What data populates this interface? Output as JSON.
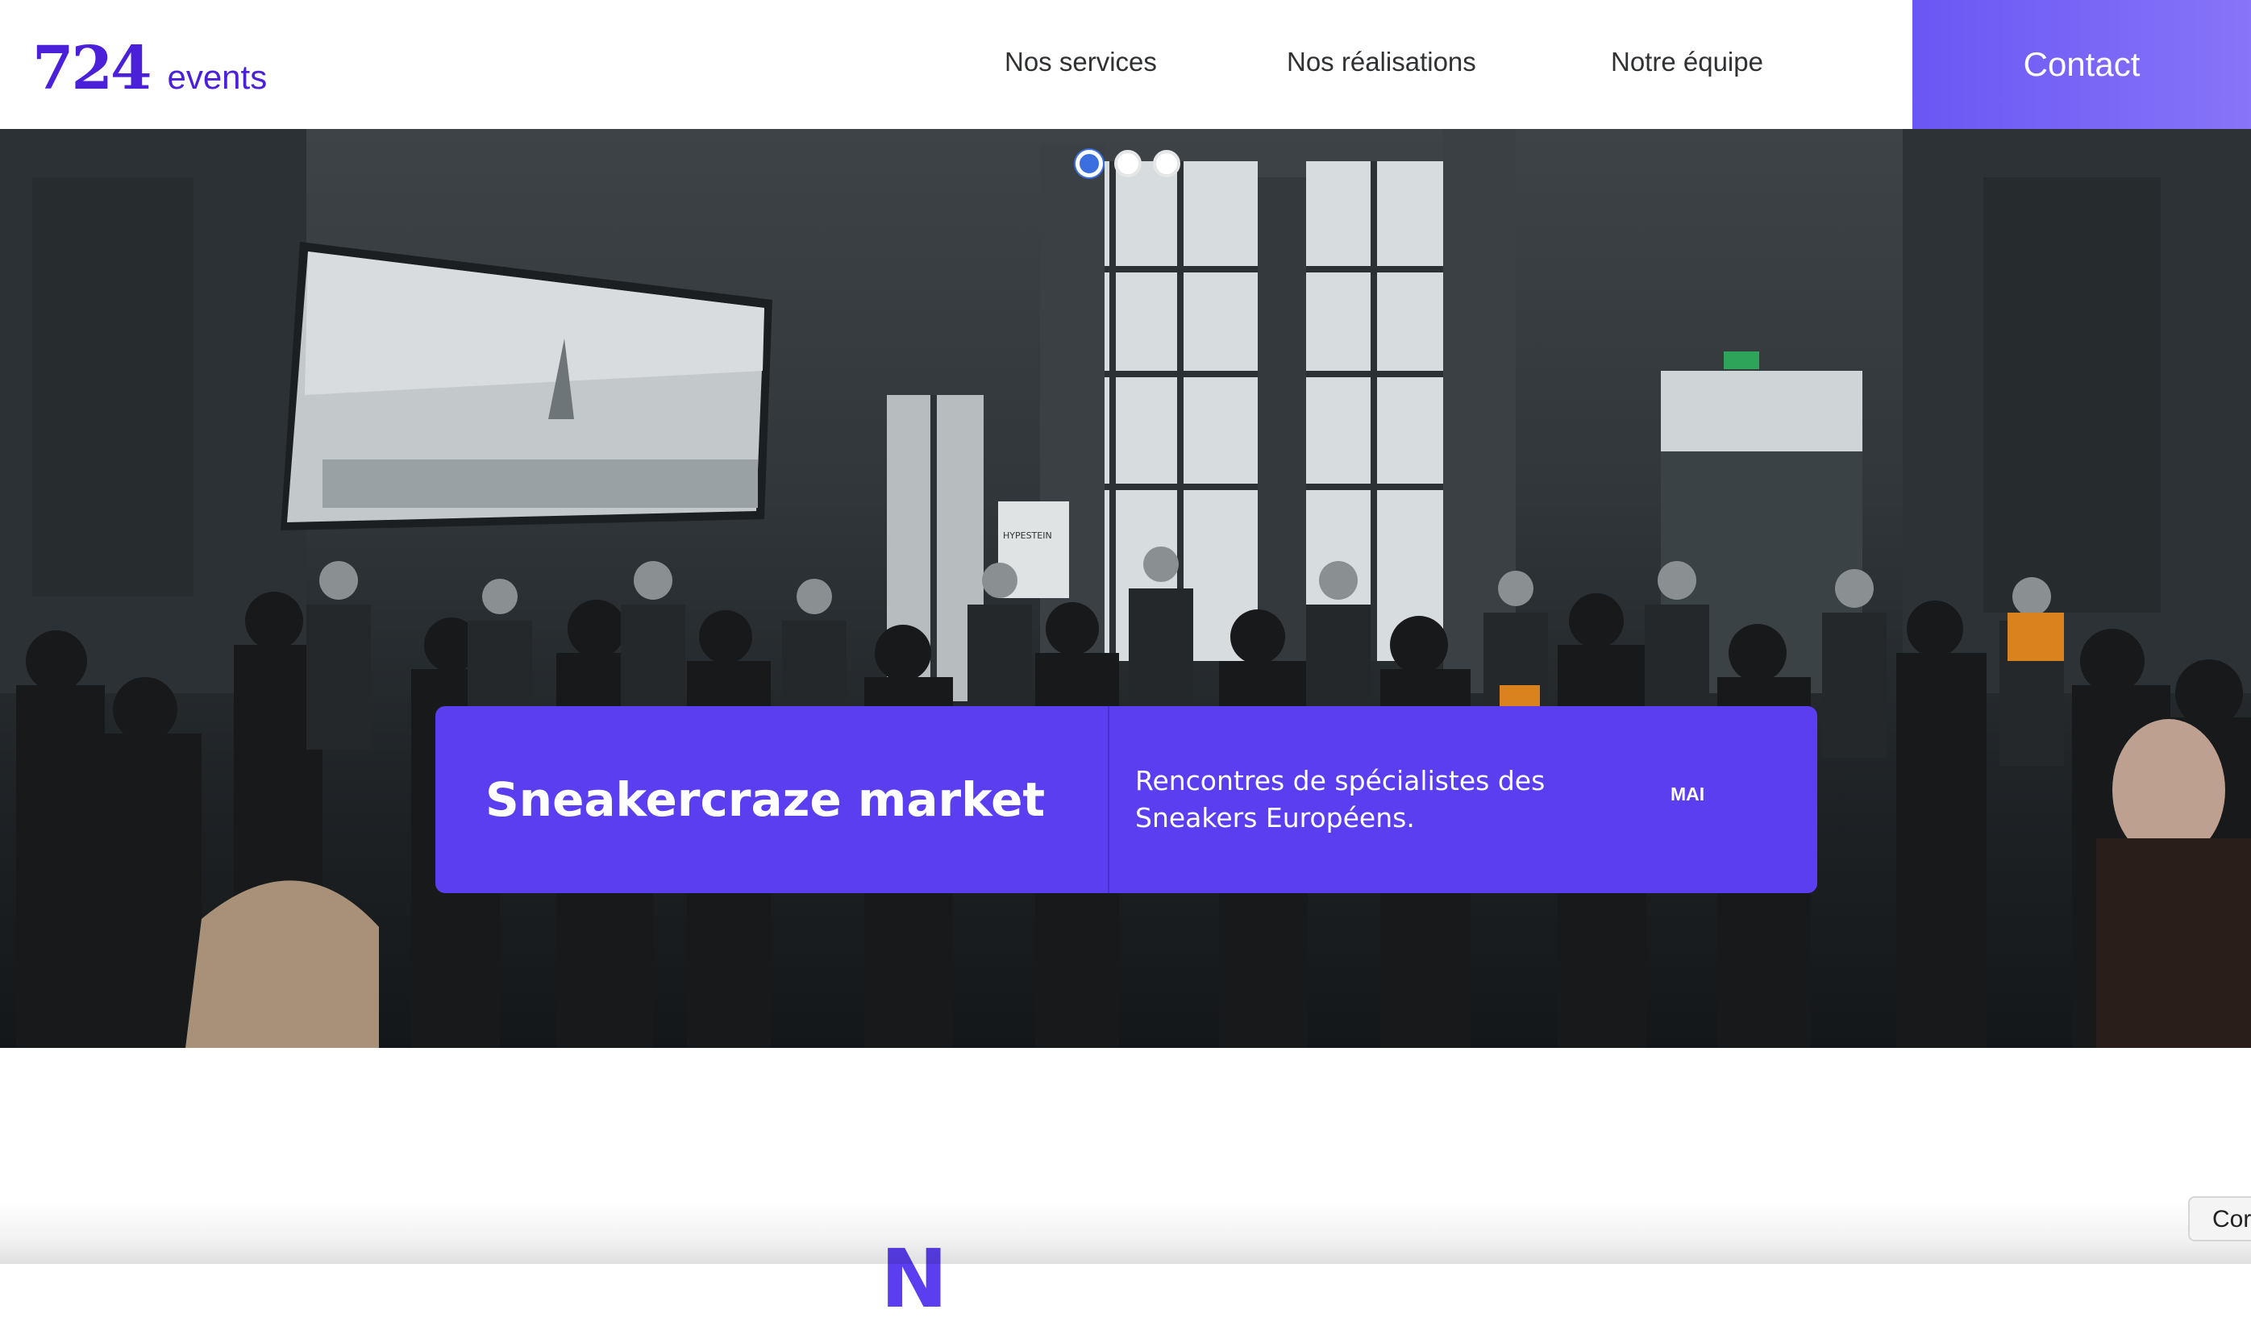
{
  "header": {
    "logo_number": "724",
    "logo_word": "events",
    "nav": {
      "services": "Nos services",
      "realisations": "Nos réalisations",
      "equipe": "Notre équipe"
    },
    "contact_label": "Contact"
  },
  "hero": {
    "slides_count": 3,
    "active_slide": 1,
    "event": {
      "title": "Sneakercraze market",
      "description_line1": "Rencontres de spécialistes des",
      "description_line2": "Sneakers Européens.",
      "month": "MAI"
    },
    "photo_signage": {
      "stand_sign": "HYPESTEIN"
    }
  },
  "section": {
    "heading_partial": "N"
  },
  "cookie_button_partial": "Cor",
  "colors": {
    "brand": "#4a20d9",
    "card": "#5a3ef0",
    "contact_gradient_start": "#6a57f4",
    "contact_gradient_end": "#8774f8",
    "nav_text": "#2f3133",
    "active_dot": "#3b6fe0"
  }
}
